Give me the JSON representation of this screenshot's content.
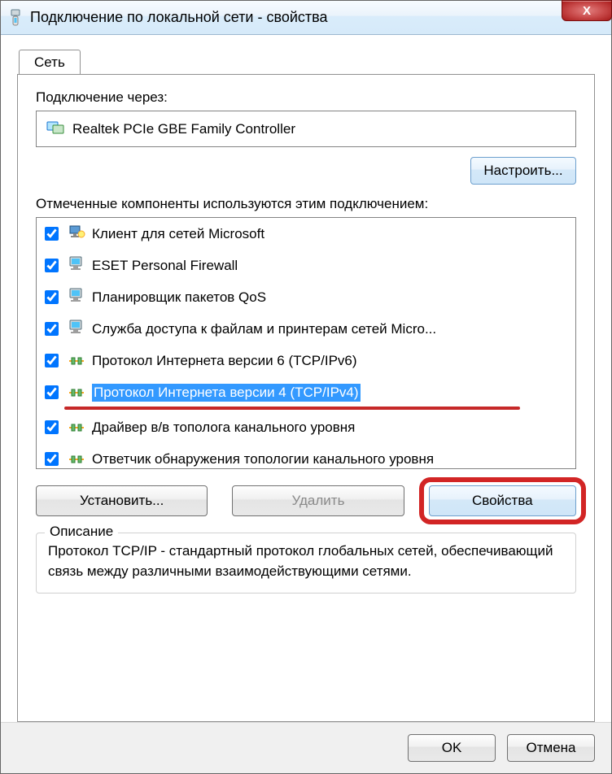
{
  "window": {
    "title": "Подключение по локальной сети - свойства",
    "close_glyph": "X"
  },
  "tabs": {
    "network": "Сеть"
  },
  "connection": {
    "label": "Подключение через:",
    "adapter": "Realtek PCIe GBE Family Controller",
    "configure": "Настроить..."
  },
  "components": {
    "label": "Отмеченные компоненты используются этим подключением:",
    "items": [
      {
        "checked": true,
        "icon": "client",
        "label": "Клиент для сетей Microsoft",
        "selected": false
      },
      {
        "checked": true,
        "icon": "pc",
        "label": "ESET Personal Firewall",
        "selected": false
      },
      {
        "checked": true,
        "icon": "pc",
        "label": "Планировщик пакетов QoS",
        "selected": false
      },
      {
        "checked": true,
        "icon": "pc",
        "label": "Служба доступа к файлам и принтерам сетей Micro...",
        "selected": false
      },
      {
        "checked": true,
        "icon": "net",
        "label": "Протокол Интернета версии 6 (TCP/IPv6)",
        "selected": false
      },
      {
        "checked": true,
        "icon": "net",
        "label": "Протокол Интернета версии 4 (TCP/IPv4)",
        "selected": true
      },
      {
        "checked": true,
        "icon": "net",
        "label": "Драйвер в/в тополога канального уровня",
        "selected": false
      },
      {
        "checked": true,
        "icon": "net",
        "label": "Ответчик обнаружения топологии канального уровня",
        "selected": false
      }
    ]
  },
  "actions": {
    "install": "Установить...",
    "uninstall": "Удалить",
    "properties": "Свойства"
  },
  "description": {
    "title": "Описание",
    "text": "Протокол TCP/IP - стандартный протокол глобальных сетей, обеспечивающий связь между различными взаимодействующими сетями."
  },
  "dialog": {
    "ok": "OK",
    "cancel": "Отмена"
  }
}
